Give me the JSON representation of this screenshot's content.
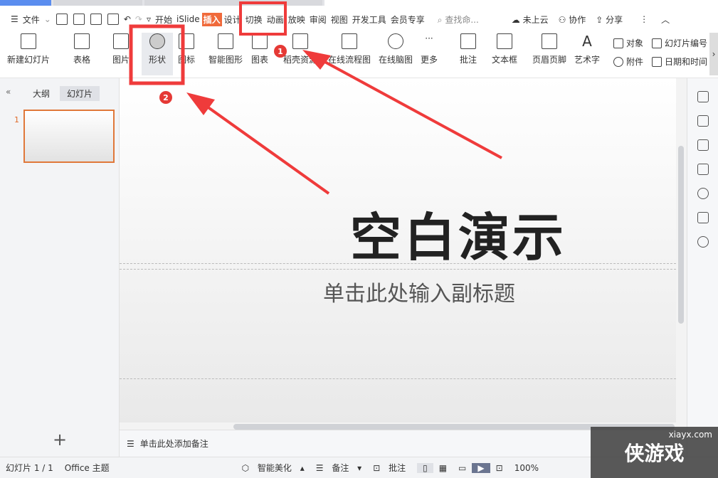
{
  "menubar": {
    "file": "文件",
    "tabs": [
      "开始",
      "iSlide",
      "插入",
      "设计",
      "切换",
      "动画",
      "放映",
      "审阅",
      "视图",
      "开发工具",
      "会员专享"
    ],
    "active_tab": "插入",
    "search": "查找命...",
    "cloud": "未上云",
    "collab": "协作",
    "share": "分享"
  },
  "ribbon": {
    "new_slide": "新建幻灯片",
    "table": "表格",
    "picture": "图片",
    "shape": "形状",
    "icon": "图标",
    "smartart": "智能图形",
    "chart": "图表",
    "resources": "稻壳资源",
    "flowchart": "在线流程图",
    "mindmap": "在线脑图",
    "more": "更多",
    "comment": "批注",
    "textbox": "文本框",
    "header_footer": "页眉页脚",
    "wordart": "艺术字",
    "object": "对象",
    "attachment": "附件",
    "slide_number": "幻灯片编号",
    "datetime": "日期和时间"
  },
  "left_panel": {
    "outline": "大纲",
    "slides": "幻灯片",
    "slide_num": "1",
    "add": "+"
  },
  "slide": {
    "title": "空白演示",
    "subtitle": "单击此处输入副标题"
  },
  "notes": {
    "placeholder": "单击此处添加备注"
  },
  "status": {
    "slide": "幻灯片 1 / 1",
    "theme": "Office 主题",
    "beautify": "智能美化",
    "notes": "备注",
    "comment": "批注",
    "zoom": "100%"
  },
  "annotations": {
    "label1": "1",
    "label2": "2",
    "color": "#ef3b3b"
  },
  "watermark": {
    "site": "xiayx.com",
    "text": "侠游戏"
  }
}
